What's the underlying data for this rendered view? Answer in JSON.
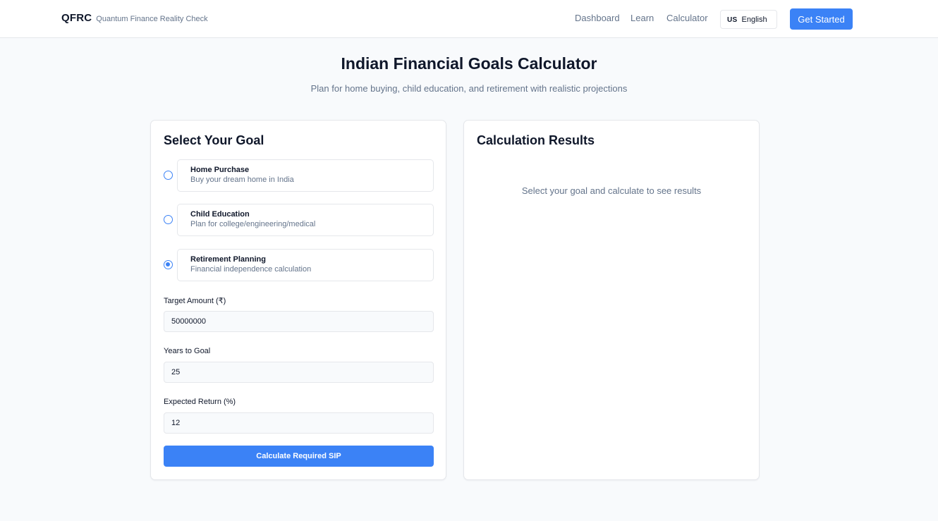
{
  "header": {
    "brand": "QFRC",
    "tagline": "Quantum Finance Reality Check",
    "nav": [
      {
        "label": "Dashboard"
      },
      {
        "label": "Learn"
      },
      {
        "label": "Calculator"
      }
    ],
    "language": {
      "flag": "US",
      "label": "English"
    },
    "cta_label": "Get Started"
  },
  "page": {
    "title": "Indian Financial Goals Calculator",
    "subtitle": "Plan for home buying, child education, and retirement with realistic projections"
  },
  "goal_card": {
    "title": "Select Your Goal",
    "selected_goal": "Retirement Planning",
    "goals": [
      {
        "name": "Home Purchase",
        "description": "Buy your dream home in India",
        "selected": false
      },
      {
        "name": "Child Education",
        "description": "Plan for college/engineering/medical",
        "selected": false
      },
      {
        "name": "Retirement Planning",
        "description": "Financial independence calculation",
        "selected": true
      }
    ],
    "fields": {
      "target_amount": {
        "label": "Target Amount (₹)",
        "value": "50000000"
      },
      "years": {
        "label": "Years to Goal",
        "value": "25"
      },
      "expected_return": {
        "label": "Expected Return (%)",
        "value": "12"
      }
    },
    "submit_label": "Calculate Required SIP"
  },
  "results_card": {
    "title": "Calculation Results",
    "empty_message": "Select your goal and calculate to see results"
  },
  "colors": {
    "accent": "#3b82f6",
    "background": "#f8fafc",
    "muted_text": "#64748b",
    "border": "#e5e7eb"
  }
}
